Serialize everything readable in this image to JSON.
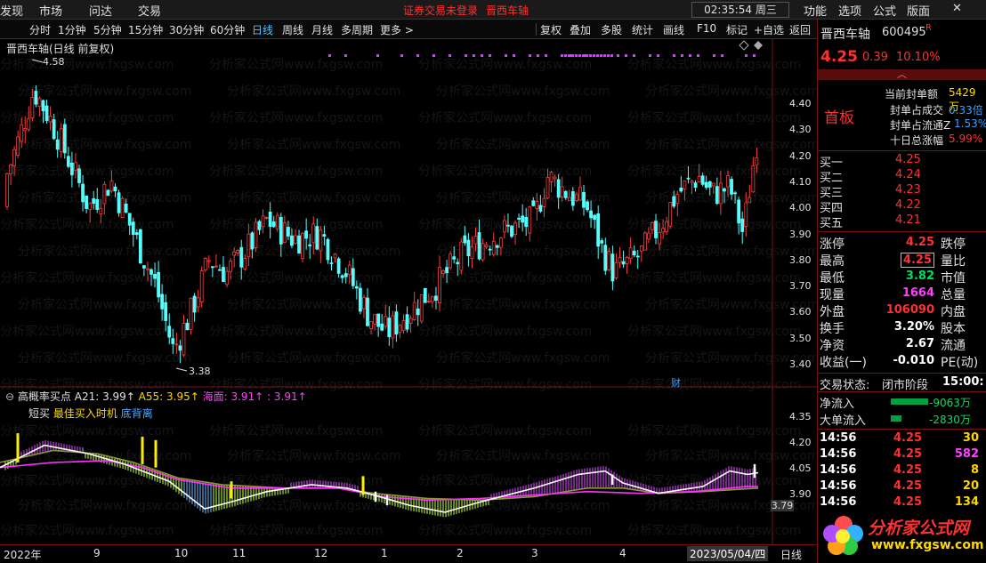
{
  "topbar": {
    "menus": [
      "发现",
      "市场",
      "问达",
      "交易"
    ],
    "warning": "证券交易未登录",
    "stock_link": "晋西车轴",
    "clock": "02:35:54 周三",
    "right_menus": [
      "功能",
      "选项",
      "公式",
      "版面"
    ],
    "window_buttons": [
      "—",
      "❐",
      "✕"
    ]
  },
  "toolbar": {
    "periods": [
      "分时",
      "1分钟",
      "5分钟",
      "15分钟",
      "30分钟",
      "60分钟",
      "日线",
      "周线",
      "月线",
      "多周期",
      "更多 >"
    ],
    "active": "日线",
    "right_items": [
      "复权",
      "叠加",
      "多股",
      "统计",
      "画线",
      "F10",
      "标记",
      "+自选",
      "返回"
    ]
  },
  "chart_title": "晋西车轴(日线 前复权)",
  "watermark": "分析家公式网www.fxgsw.com",
  "main_chart": {
    "high_label": "4.58",
    "low_label": "3.38",
    "cai_badge": "财",
    "y_ticks": [
      "4.40",
      "4.30",
      "4.20",
      "4.10",
      "4.00",
      "3.90",
      "3.80",
      "3.70",
      "3.60",
      "3.50",
      "3.40"
    ]
  },
  "sub_chart": {
    "indicator_name": "高概率买点",
    "a21": "A21: 3.99↑",
    "a55": "A55: 3.95↑",
    "haimian": "海面: 3.91↑",
    "extra": ": 3.91↑",
    "legend_short": "短买",
    "legend_best": "最佳买入时机",
    "legend_div": "底背离",
    "y_ticks": [
      "4.35",
      "4.20",
      "4.05",
      "3.90"
    ],
    "current_value": "3.79"
  },
  "x_axis": {
    "labels": [
      "2022年",
      "9",
      "10",
      "11",
      "12",
      "1",
      "2",
      "3",
      "4"
    ],
    "cursor_date": "2023/05/04/四",
    "right_label": "日线"
  },
  "quote": {
    "name": "晋西车轴",
    "code": "600495",
    "r_flag": "R",
    "price": "4.25",
    "change": "0.39",
    "pct": "10.10%",
    "first_board": "首板",
    "seal_amount_label": "当前封单额",
    "seal_amount": "5429万",
    "seal_trade_label": "封单占成交",
    "seal_trade": "0.33倍",
    "seal_float_label": "封单占流通Z",
    "seal_float": "1.53%",
    "ten_day_label": "十日总涨幅",
    "ten_day": "5.99%"
  },
  "bids": [
    {
      "label": "买一",
      "price": "4.25"
    },
    {
      "label": "买二",
      "price": "4.24"
    },
    {
      "label": "买三",
      "price": "4.23"
    },
    {
      "label": "买四",
      "price": "4.22"
    },
    {
      "label": "买五",
      "price": "4.21"
    }
  ],
  "stats": [
    {
      "l1": "涨停",
      "v1": "4.25",
      "l2": "跌停",
      "v2": ""
    },
    {
      "l1": "最高",
      "v1": "4.25",
      "l2": "量比",
      "v2": ""
    },
    {
      "l1": "最低",
      "v1": "3.82",
      "l2": "市值",
      "v2": ""
    },
    {
      "l1": "现量",
      "v1": "1664",
      "l2": "总量",
      "v2": ""
    },
    {
      "l1": "外盘",
      "v1": "106090",
      "l2": "内盘",
      "v2": ""
    },
    {
      "l1": "换手",
      "v1": "3.20%",
      "l2": "股本",
      "v2": ""
    },
    {
      "l1": "净资",
      "v1": "2.67",
      "l2": "流通",
      "v2": ""
    },
    {
      "l1": "收益(一)",
      "v1": "-0.010",
      "l2": "PE(动)",
      "v2": ""
    }
  ],
  "trade_status": {
    "label": "交易状态:",
    "value": "闭市阶段",
    "time": "15:00:"
  },
  "flows": [
    {
      "label": "净流入",
      "value": "-9063万"
    },
    {
      "label": "大单流入",
      "value": "-2830万"
    }
  ],
  "ticks": [
    {
      "time": "14:56",
      "price": "4.25",
      "vol": "30"
    },
    {
      "time": "14:56",
      "price": "4.25",
      "vol": "582"
    },
    {
      "time": "14:56",
      "price": "4.25",
      "vol": "8"
    },
    {
      "time": "14:56",
      "price": "4.25",
      "vol": "20"
    },
    {
      "time": "14:56",
      "price": "4.25",
      "vol": "134"
    }
  ],
  "logo_text": "分析家公式网",
  "logo_url": "www.fxgsw.com"
}
